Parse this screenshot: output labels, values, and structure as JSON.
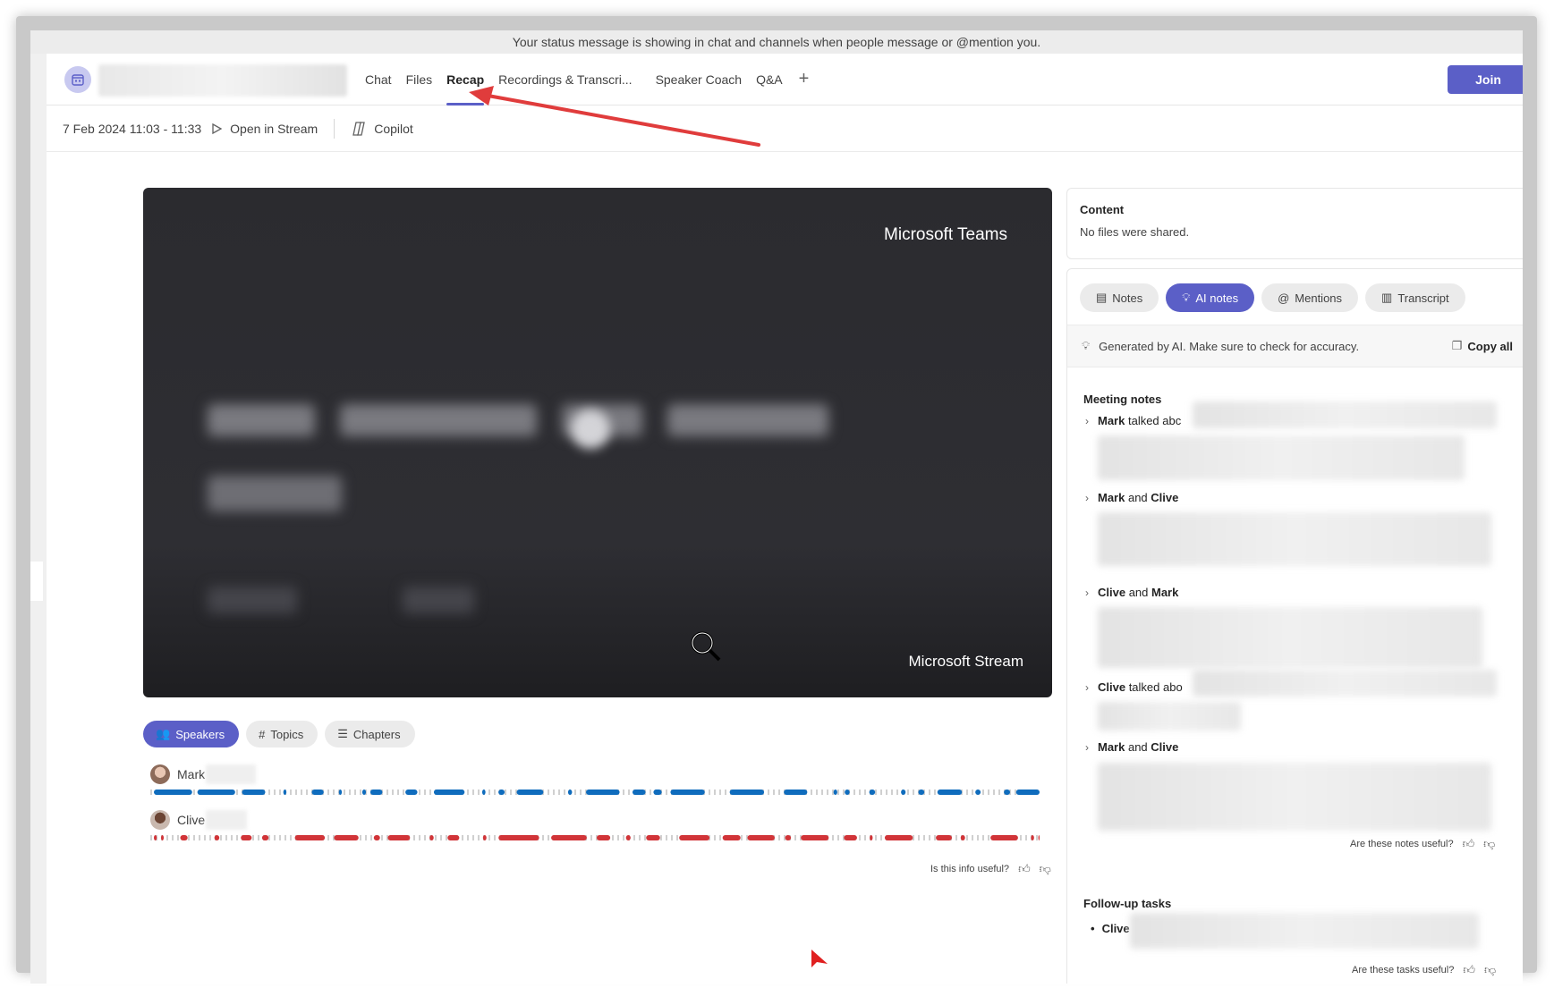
{
  "status_message": "Your status message is showing in chat and channels when people message or @mention you.",
  "header": {
    "tabs": [
      {
        "label": "Chat"
      },
      {
        "label": "Files"
      },
      {
        "label": "Recap"
      },
      {
        "label": "Recordings & Transcri..."
      },
      {
        "label": "Speaker Coach"
      },
      {
        "label": "Q&A"
      }
    ],
    "active_tab": "Recap",
    "add_tab_icon": "plus-icon",
    "join_label": "Join"
  },
  "subheader": {
    "date_time": "7 Feb 2024 11:03 - 11:33",
    "open_stream_label": "Open in Stream",
    "copilot_label": "Copilot"
  },
  "video": {
    "brand_top": "Microsoft Teams",
    "brand_bottom": "Microsoft Stream"
  },
  "view_tabs": [
    {
      "label": "Speakers",
      "icon": "people-icon"
    },
    {
      "label": "Topics",
      "icon": "hash-icon"
    },
    {
      "label": "Chapters",
      "icon": "list-icon"
    }
  ],
  "speakers": [
    {
      "name": "Mark",
      "color": "#0f6cbd"
    },
    {
      "name": "Clive",
      "color": "#d13438"
    }
  ],
  "info_useful": "Is this info useful?",
  "content_card": {
    "title": "Content",
    "text": "No files were shared."
  },
  "notes_tabs": [
    {
      "label": "Notes",
      "icon": "notes-icon"
    },
    {
      "label": "AI notes",
      "icon": "lightbulb-icon"
    },
    {
      "label": "Mentions",
      "icon": "at-icon"
    },
    {
      "label": "Transcript",
      "icon": "transcript-icon"
    }
  ],
  "ai_disclaimer": "Generated by AI. Make sure to check for accuracy.",
  "copy_all": "Copy all",
  "meeting_notes": {
    "title": "Meeting notes",
    "items": [
      {
        "bold1": "Mark",
        "mid": " talked abc",
        "bold2": ""
      },
      {
        "bold1": "Mark",
        "mid": " and ",
        "bold2": "Clive"
      },
      {
        "bold1": "Clive",
        "mid": " and ",
        "bold2": "Mark"
      },
      {
        "bold1": "Clive",
        "mid": " talked abo",
        "bold2": ""
      },
      {
        "bold1": "Mark",
        "mid": " and ",
        "bold2": "Clive"
      }
    ],
    "useful": "Are these notes useful?"
  },
  "follow_up": {
    "title": "Follow-up tasks",
    "task": "Clive",
    "useful": "Are these tasks useful?"
  },
  "colors": {
    "accent": "#5b5fc7",
    "annotation_arrow": "#e03c3c"
  }
}
